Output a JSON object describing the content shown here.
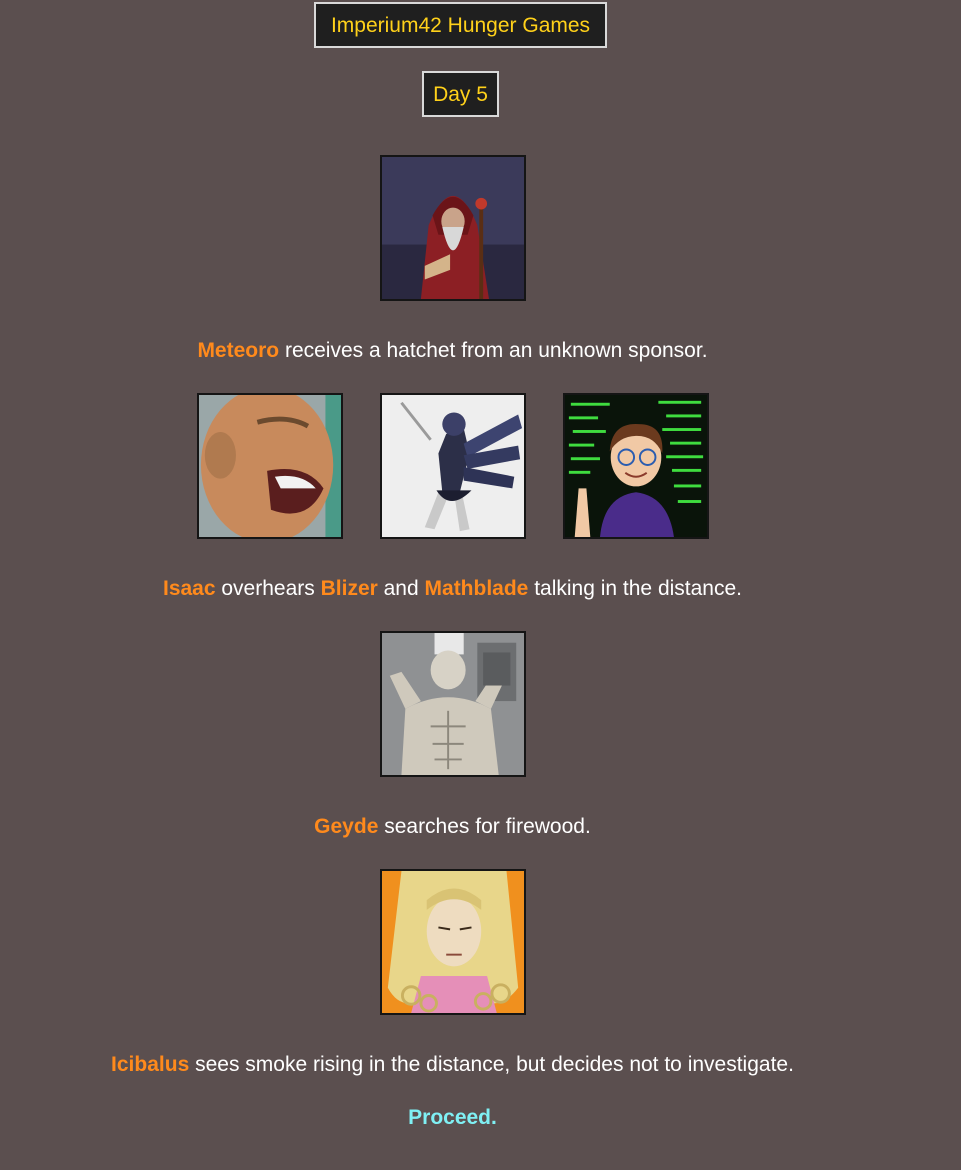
{
  "header": {
    "title": "Imperium42 Hunger Games",
    "day_label": "Day 5"
  },
  "events": [
    {
      "avatars": [
        "red-hooded-wizard-portrait"
      ],
      "parts": [
        {
          "name": "Meteoro"
        },
        {
          "text": " receives a hatchet from an unknown sponsor."
        }
      ]
    },
    {
      "avatars": [
        "shouting-boy-portrait",
        "armored-robot-portrait",
        "cartoon-coder-portrait"
      ],
      "parts": [
        {
          "name": "Isaac"
        },
        {
          "text": " overhears "
        },
        {
          "name": "Blizer"
        },
        {
          "text": " and "
        },
        {
          "name": "Mathblade"
        },
        {
          "text": " talking in the distance."
        }
      ]
    },
    {
      "avatars": [
        "muscular-chef-portrait"
      ],
      "parts": [
        {
          "name": "Geyde"
        },
        {
          "text": " searches for firewood."
        }
      ]
    },
    {
      "avatars": [
        "blonde-anime-character-portrait"
      ],
      "parts": [
        {
          "name": "Icibalus"
        },
        {
          "text": " sees smoke rising in the distance, but decides not to investigate."
        }
      ]
    }
  ],
  "proceed_label": "Proceed.",
  "colors": {
    "background": "#5b4f4f",
    "title_text": "#ffd11a",
    "tribute_name": "#ff8a1c",
    "proceed_link": "#7ff0f4"
  }
}
